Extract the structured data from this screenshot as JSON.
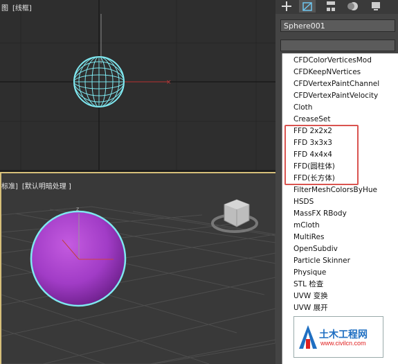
{
  "viewport_top": {
    "label_left": "图",
    "label_wire": "[线框]"
  },
  "viewport_persp": {
    "label_left": "标准]",
    "label_shading": "[默认明暗处理 ]"
  },
  "command_panel": {
    "tabs": [
      {
        "icon": "plus-create-icon"
      },
      {
        "icon": "modify-icon"
      },
      {
        "icon": "hierarchy-icon"
      },
      {
        "icon": "motion-icon"
      },
      {
        "icon": "display-icon"
      }
    ],
    "object_name": "Sphere001",
    "modifier_list_value": ""
  },
  "modifier_list": [
    "CFDColorVerticesMod",
    "CFDKeepNVertices",
    "CFDVertexPaintChannel",
    "CFDVertexPaintVelocity",
    "Cloth",
    "CreaseSet",
    "FFD 2x2x2",
    "FFD 3x3x3",
    "FFD 4x4x4",
    "FFD(圆柱体)",
    "FFD(长方体)",
    "FilterMeshColorsByHue",
    "HSDS",
    "MassFX RBody",
    "mCloth",
    "MultiRes",
    "OpenSubdiv",
    "Particle Skinner",
    "Physique",
    "STL 检查",
    "UVW 变换",
    "UVW 展开"
  ],
  "watermark": {
    "title": "土木工程网",
    "url": "www.civilcn.com"
  },
  "colors": {
    "highlight": "#d9534f",
    "sphere": "#a13cc6",
    "wire": "#7fe8f0"
  }
}
